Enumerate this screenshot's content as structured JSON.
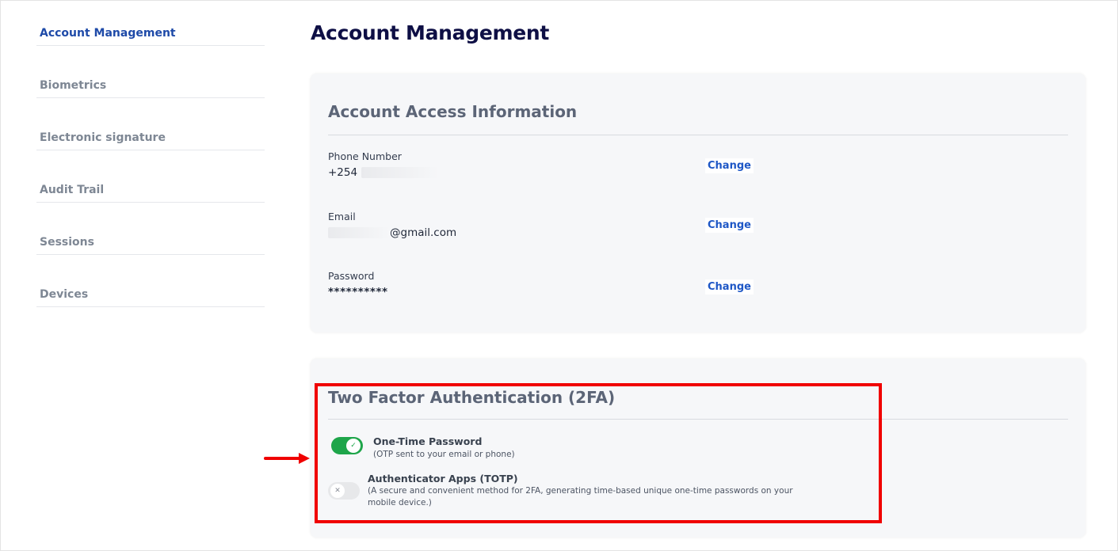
{
  "sidebar": {
    "items": [
      {
        "label": "Account Management",
        "active": true
      },
      {
        "label": "Biometrics"
      },
      {
        "label": "Electronic signature"
      },
      {
        "label": "Audit Trail"
      },
      {
        "label": "Sessions"
      },
      {
        "label": "Devices"
      }
    ]
  },
  "page": {
    "title": "Account Management"
  },
  "access": {
    "title": "Account Access Information",
    "phone": {
      "label": "Phone Number",
      "prefix": "+254",
      "change": "Change"
    },
    "email": {
      "label": "Email",
      "suffix": "@gmail.com",
      "change": "Change"
    },
    "password": {
      "label": "Password",
      "value": "**********",
      "change": "Change"
    }
  },
  "tfa": {
    "title": "Two Factor Authentication (2FA)",
    "otp": {
      "title": "One-Time Password",
      "desc": "(OTP sent to your email or phone)",
      "enabled": true
    },
    "totp": {
      "title": "Authenticator Apps (TOTP)",
      "desc": "(A secure and convenient method for 2FA, generating time-based unique one-time passwords on your mobile device.)",
      "enabled": false
    }
  },
  "colors": {
    "accent": "#1e4aa8",
    "toggle_on": "#1ea54a",
    "highlight": "#f00000"
  },
  "icons": {
    "toggle_on_knob": "check-icon",
    "toggle_off_knob": "x-icon",
    "annotation": "arrow-right-icon"
  }
}
